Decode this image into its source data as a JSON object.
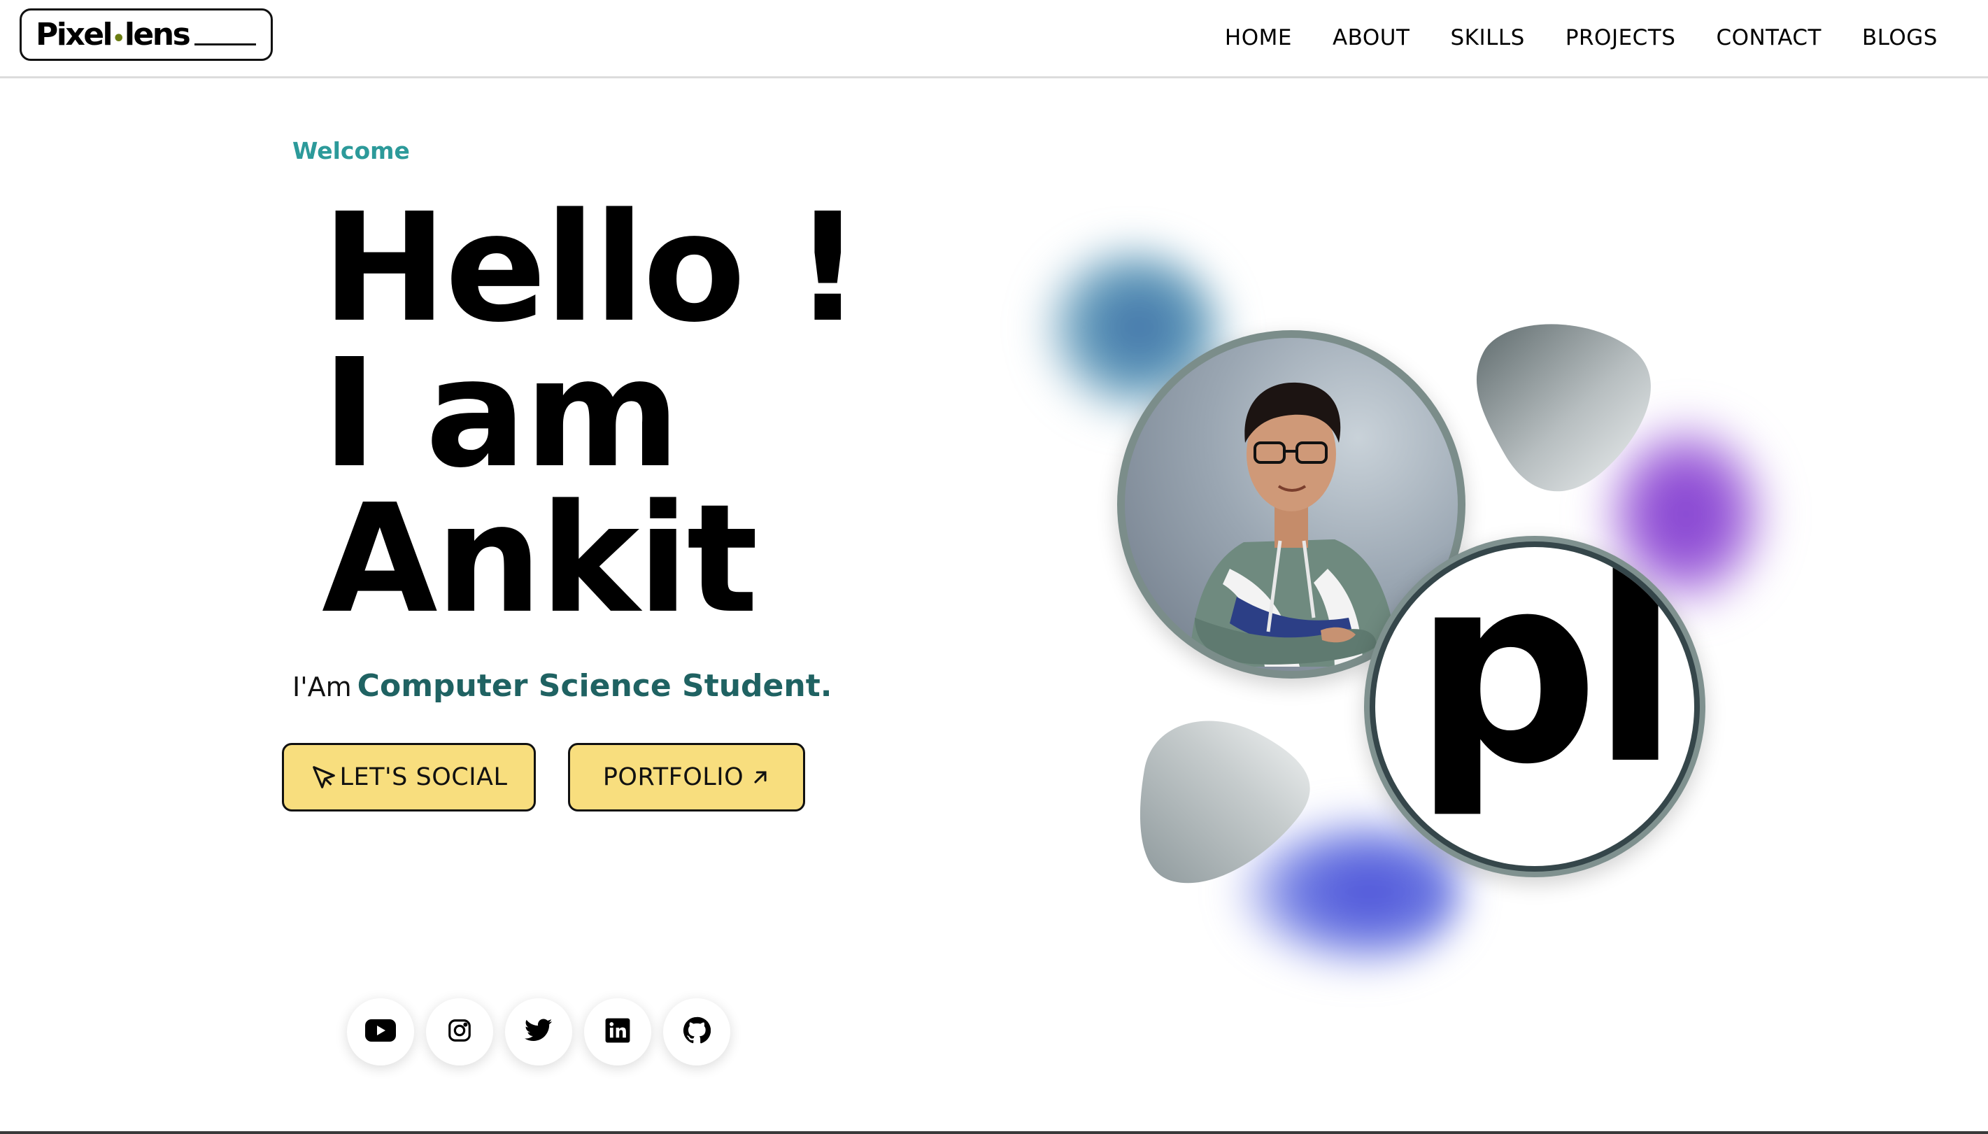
{
  "header": {
    "logo": {
      "text_main": "Pixel",
      "text_dot": "•",
      "text_end": "lens"
    },
    "nav": [
      "HOME",
      "ABOUT",
      "SKILLS",
      "PROJECTS",
      "CONTACT",
      "BLOGS"
    ]
  },
  "hero": {
    "welcome": "Welcome",
    "headline": [
      "Hello !",
      "I am",
      "Ankit"
    ],
    "role_prefix": "I'Am",
    "role_highlight": "Computer Science Student.",
    "buttons": {
      "social": "LET'S SOCIAL",
      "portfolio": "PORTFOLIO"
    },
    "badge_text": "pl"
  },
  "socials": [
    "youtube-icon",
    "instagram-icon",
    "twitter-icon",
    "linkedin-icon",
    "github-icon"
  ],
  "colors": {
    "accent_teal": "#2c9a9a",
    "role_teal": "#1f6262",
    "button_yellow": "#f8de7e",
    "blob_purple": "#8040d0",
    "blob_blue": "#4a4fd8",
    "blob_teal": "#3f6ea8"
  }
}
